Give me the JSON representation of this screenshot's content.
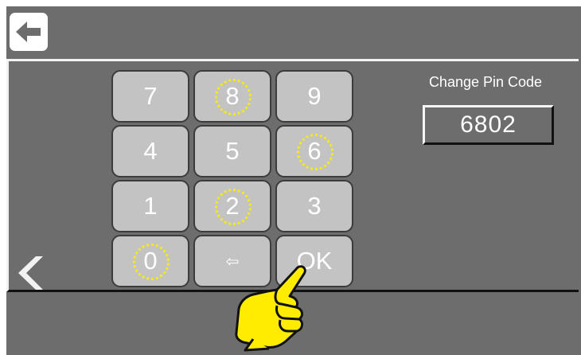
{
  "header": {
    "back_icon": "arrow-left-icon"
  },
  "nav": {
    "prev_icon": "chevron-left-icon"
  },
  "keypad": {
    "keys": [
      {
        "label": "7",
        "highlighted": false
      },
      {
        "label": "8",
        "highlighted": true
      },
      {
        "label": "9",
        "highlighted": false
      },
      {
        "label": "4",
        "highlighted": false
      },
      {
        "label": "5",
        "highlighted": false
      },
      {
        "label": "6",
        "highlighted": true
      },
      {
        "label": "1",
        "highlighted": false
      },
      {
        "label": "2",
        "highlighted": true
      },
      {
        "label": "3",
        "highlighted": false
      },
      {
        "label": "0",
        "highlighted": true
      },
      {
        "label": "⇦",
        "highlighted": false
      },
      {
        "label": "OK",
        "highlighted": false
      }
    ],
    "highlight_color": "#f4ea1a"
  },
  "pin": {
    "title": "Change Pin Code",
    "value": "6802"
  },
  "overlay": {
    "hand_icon": "pointing-hand-icon",
    "hand_color": "#ffec00"
  }
}
